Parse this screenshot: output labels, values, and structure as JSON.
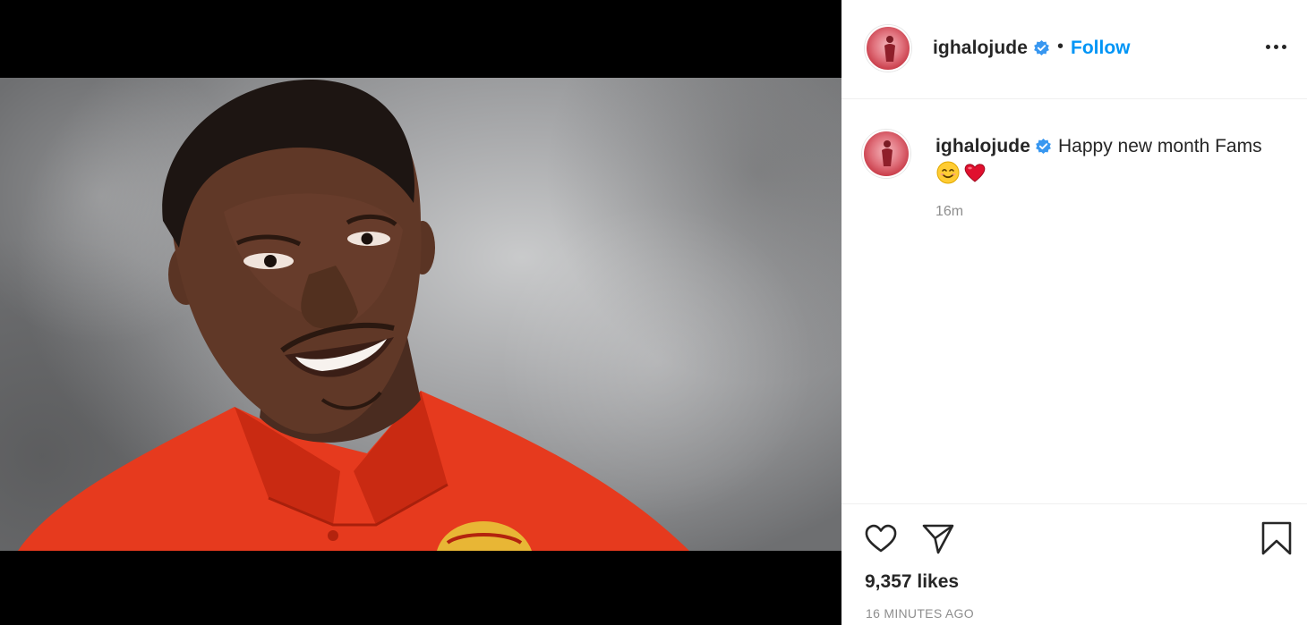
{
  "post": {
    "username": "ighalojude",
    "follow_label": "Follow",
    "separator": "•",
    "caption_text": "Happy new month Fams",
    "caption_emojis": [
      "smiling-face-emoji",
      "red-heart-emoji"
    ],
    "relative_time": "16m",
    "likes": "9,357 likes",
    "posted_ago": "16 MINUTES AGO"
  },
  "colors": {
    "link_blue": "#0095f6",
    "verified_blue": "#3897f0",
    "muted_gray": "#8e8e8e",
    "heart_red": "#e0245e",
    "shirt_red": "#e63a1e"
  },
  "icons": {
    "more": "more-options-icon",
    "like": "heart-outline-icon",
    "share": "paper-plane-icon",
    "save": "bookmark-outline-icon",
    "verified": "verified-badge-icon"
  }
}
